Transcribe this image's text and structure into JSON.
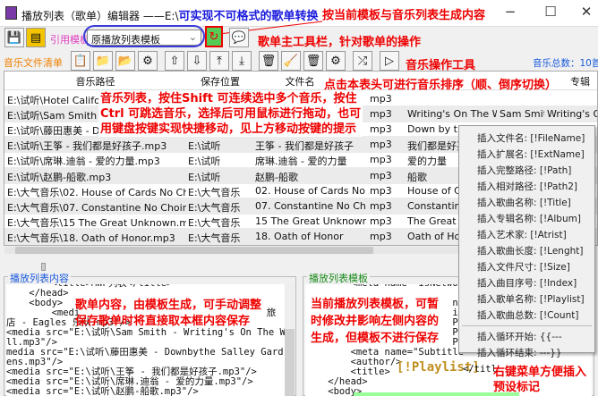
{
  "window": {
    "title": "播放列表（歌单）编辑器 ——E:\\",
    "title_annotation": "可实现不可格式的歌单转换",
    "minimize": "−",
    "maximize": "☐",
    "close": "✕"
  },
  "annotations": {
    "generate": "按当前模板与音乐列表生成内容",
    "main_toolbar": "歌单主工具栏，针对歌单的操作",
    "music_tools": "音乐操作工具",
    "sort_hint": "点击本表头可进行音乐排序（顺、倒序切换）",
    "list_hint": [
      "音乐列表，按住Shift 可连续选中多个音乐，按住",
      "Ctrl 可跳选音乐，选择后可用鼠标进行拖动，也可",
      "用键盘按键实现快捷移动，见上方移动按键的提示"
    ],
    "content_hint": [
      "歌单内容，由模板生成，可手动调整",
      "保存歌单时将直接取本框内容保存"
    ],
    "template_hint": [
      "当前播放列表模板，可暂",
      "时修改并影响左侧内容的",
      "生成，但模板不进行保存"
    ],
    "menu_hint": [
      "右键菜单方便插入",
      "预设标记"
    ]
  },
  "toolbar": {
    "template_label": "引用模板",
    "template_value": "原播放列表模板"
  },
  "music_toolbar": {
    "label": "音乐文件清单",
    "total": "音乐总数：10首"
  },
  "table": {
    "headers": [
      "音乐路径",
      "保存位置",
      "文件名",
      "",
      "",
      "",
      "专辑"
    ],
    "rows": [
      [
        "E:\\试听\\Hotel Califor",
        "",
        "",
        "mp3",
        "",
        "",
        ""
      ],
      [
        "E:\\试听\\Sam Smith - ",
        "",
        "",
        "mp3",
        "Writing's On The W",
        "Sam Smit",
        "Writing's On"
      ],
      [
        "E:\\试听\\藤田惠美 - Dc",
        "",
        "",
        "mp3",
        "Down by th",
        "",
        ""
      ],
      [
        "E:\\试听\\王筝 - 我们都是好孩子.mp3",
        "E:\\试听",
        "王筝 - 我们都是好孩子",
        "mp3",
        "我们都是好孩",
        "",
        ""
      ],
      [
        "E:\\试听\\席琳.迪翁 - 爱的力量.mp3",
        "E:\\试听",
        "席琳.迪翁 - 爱的力量",
        "mp3",
        "爱的力量",
        "",
        ""
      ],
      [
        "E:\\试听\\赵鹏-船歌.mp3",
        "E:\\试听",
        "赵鹏-船歌",
        "mp3",
        "船歌",
        "",
        ""
      ],
      [
        "E:\\大气音乐\\02. House of Cards No Choi",
        "E:\\大气音乐",
        "02. House of Cards No C",
        "mp3",
        "House of C",
        "",
        ""
      ],
      [
        "E:\\大气音乐\\07. Constantine No Choir.mp",
        "E:\\大气音乐",
        "07. Constantine No Choi",
        "mp3",
        "Constantine",
        "",
        ""
      ],
      [
        "E:\\大气音乐\\15 The Great Unknown.mp3",
        "E:\\大气音乐",
        "15 The Great Unknown",
        "mp3",
        "The Great U",
        "",
        ""
      ],
      [
        "E:\\大气音乐\\18. Oath of Honor.mp3",
        "E:\\大气音乐",
        "18. Oath of Honor",
        "mp3",
        "Oath of Ho",
        "",
        ""
      ]
    ]
  },
  "content_panel": {
    "label": "播放列表内容",
    "lines": [
      "        <title>MWP列表</title>",
      "    </head>",
      "    <body>",
      "        <medi                                 旅",
      "店 - Eagles 乐队.mp3\"/>",
      "<media src=\"E:\\试听\\Sam Smith - Writing's On The Wa",
      "ll.mp3\"/>",
      "media src=\"E:\\试听\\藤田惠美 - Downbythe Salley Gard",
      "ens.mp3\"/>",
      "<media src=\"E:\\试听\\王筝 - 我们都是好孩子.mp3\"/>",
      "<media src=\"E:\\试听\\席琳.迪翁 - 爱的力量.mp3\"/>",
      "<media src=\"E:\\试听\\赵鹏-船歌.mp3\"/>"
    ]
  },
  "template_panel": {
    "label": "播放列表模板",
    "lines": [
      "        <meta name=\"isNetwork",
      "",
      "                          nt",
      "                          it",
      "                          Pa",
      "                          Pa",
      "                          Pa",
      "        <meta name=\"Subtitle\"",
      "        <author/>",
      "        <title>",
      "    </head>",
      "    <body>"
    ],
    "playlist_tag": "[!Playlist]",
    "title_close": "</titl"
  },
  "context_menu": {
    "items": [
      "插入文件名: [!FileName]",
      "插入扩展名: [!ExtName]",
      "插入完整路径: [!Path]",
      "插入相对路径: [!Path2]",
      "插入歌曲名称: [!Title]",
      "插入专辑名称: [!Album]",
      "插入艺术家: [!Atrist]",
      "插入歌曲长度: [!Lenght]",
      "插入文件尺寸: [!Size]",
      "插入曲目序号: [!Index]",
      "插入歌单名称: [!Playlist]",
      "插入歌曲总数: [!Count]"
    ],
    "loop_items": [
      "插入循环开始: {{---",
      "插入循环结束: ---}}"
    ]
  }
}
